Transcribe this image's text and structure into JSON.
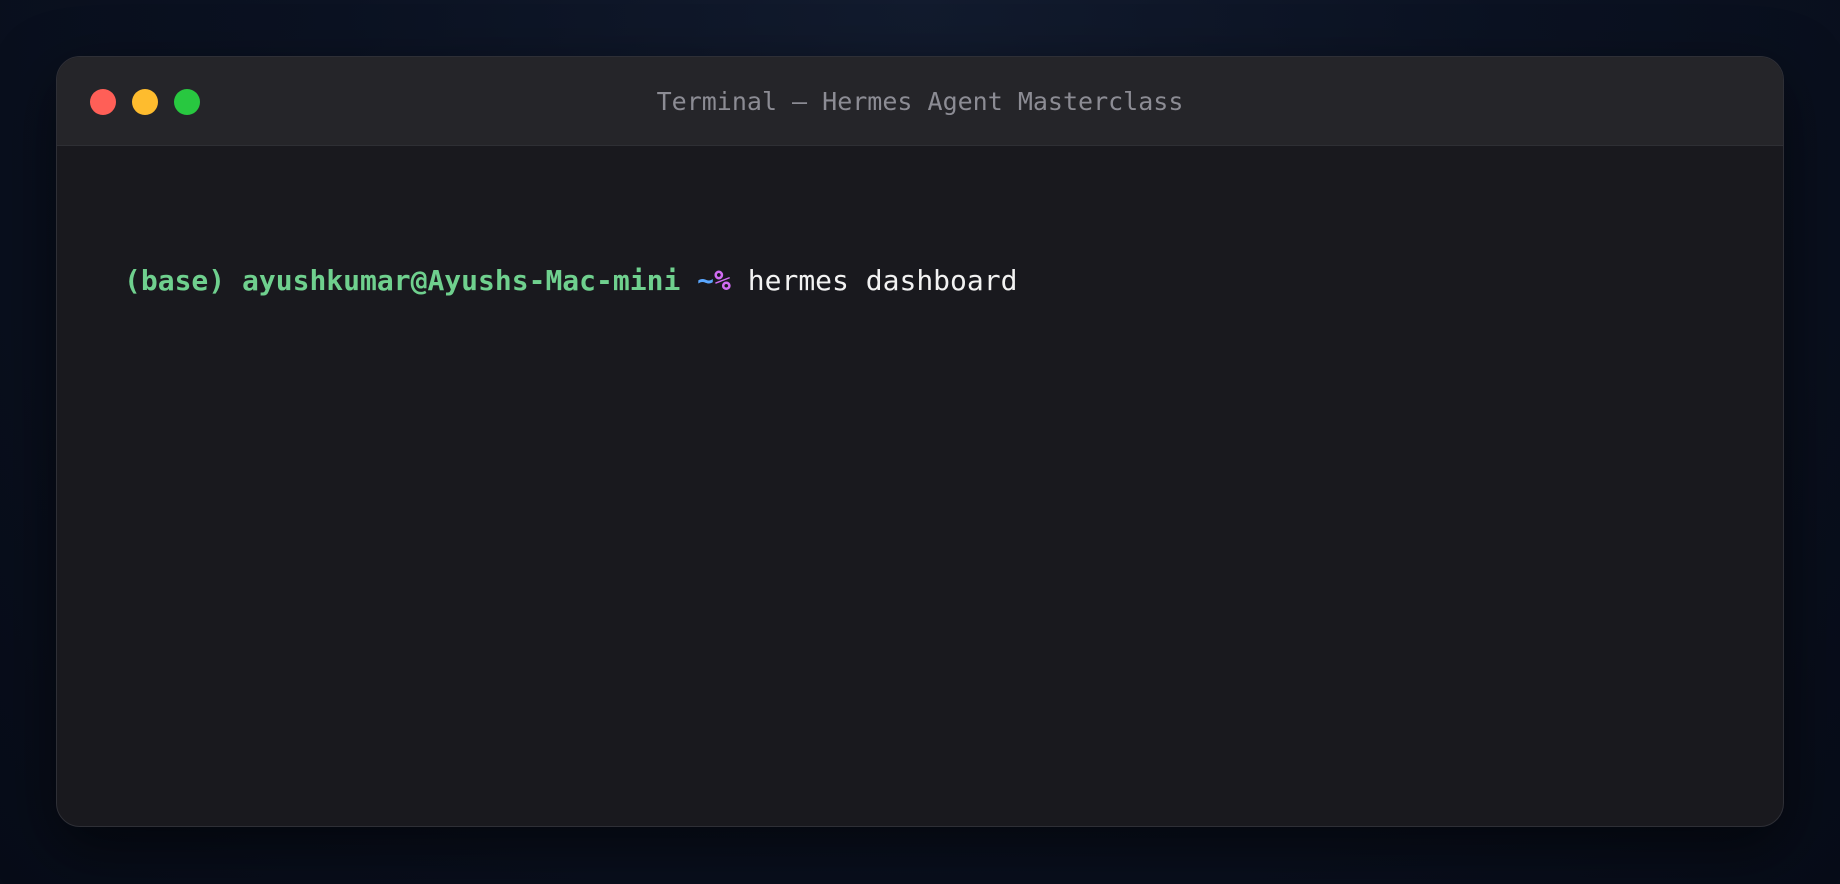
{
  "window": {
    "title": "Terminal — Hermes Agent Masterclass",
    "controls": {
      "close_color": "#ff5f57",
      "minimize_color": "#febc2e",
      "zoom_color": "#28c840"
    }
  },
  "terminal": {
    "prompt": {
      "env": "(base)",
      "user_host": "ayushkumar@Ayushs-Mac-mini",
      "cwd": "~",
      "symbol": "%"
    },
    "command": "hermes dashboard"
  }
}
